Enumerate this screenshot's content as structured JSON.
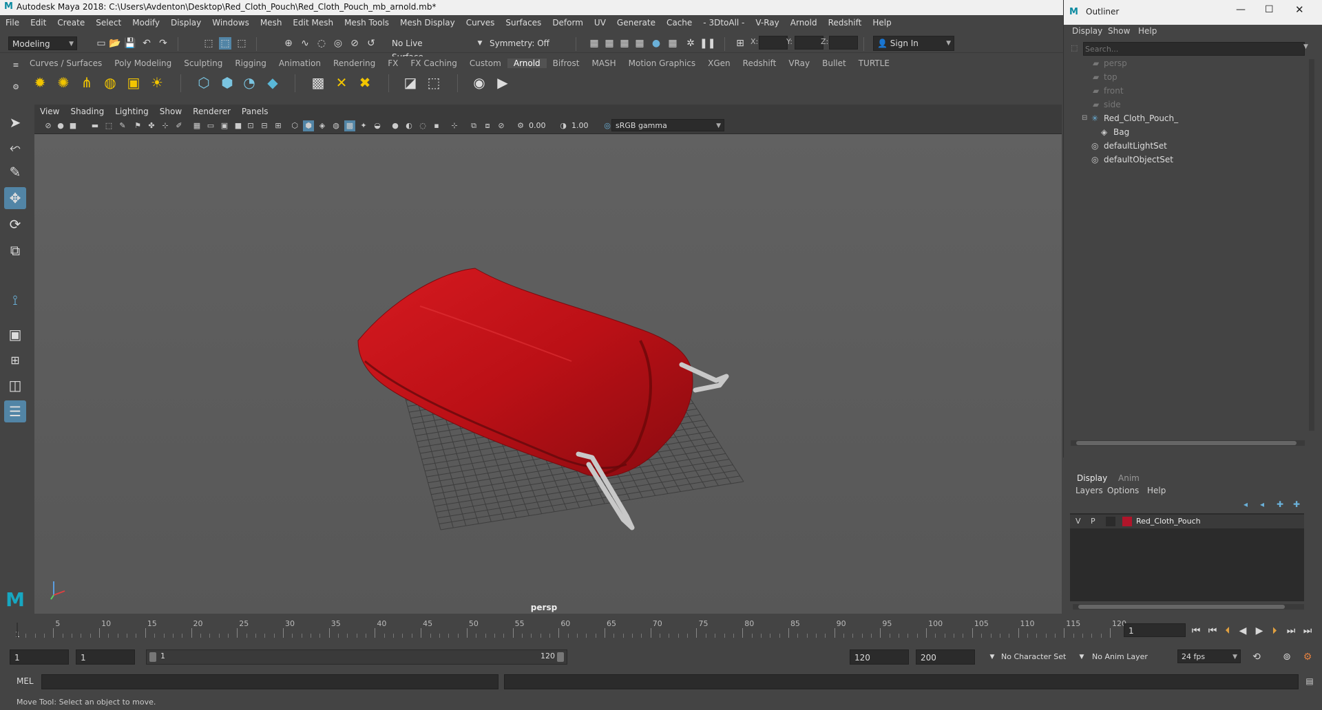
{
  "window": {
    "title": "Autodesk Maya 2018: C:\\Users\\Avdenton\\Desktop\\Red_Cloth_Pouch\\Red_Cloth_Pouch_mb_arnold.mb*",
    "logo": "M"
  },
  "menubar": [
    "File",
    "Edit",
    "Create",
    "Select",
    "Modify",
    "Display",
    "Windows",
    "Mesh",
    "Edit Mesh",
    "Mesh Tools",
    "Mesh Display",
    "Curves",
    "Surfaces",
    "Deform",
    "UV",
    "Generate",
    "Cache",
    "- 3DtoAll -",
    "V-Ray",
    "Arnold",
    "Redshift",
    "Help"
  ],
  "statusline": {
    "mode": "Modeling",
    "live_surface": "No Live Surface",
    "symmetry": "Symmetry: Off",
    "x_label": "X:",
    "y_label": "Y:",
    "z_label": "Z:",
    "sign_in": "Sign In"
  },
  "shelf": {
    "tabs": [
      "Curves / Surfaces",
      "Poly Modeling",
      "Sculpting",
      "Rigging",
      "Animation",
      "Rendering",
      "FX",
      "FX Caching",
      "Custom",
      "Arnold",
      "Bifrost",
      "MASH",
      "Motion Graphics",
      "XGen",
      "Redshift",
      "VRay",
      "Bullet",
      "TURTLE"
    ],
    "active_tab": "Arnold"
  },
  "viewport": {
    "menu": [
      "View",
      "Shading",
      "Lighting",
      "Show",
      "Renderer",
      "Panels"
    ],
    "exposure": "0.00",
    "gamma": "1.00",
    "color_space": "sRGB gamma",
    "camera": "persp",
    "object_color": "#c0141c"
  },
  "timeline": {
    "ticks": [
      "5",
      "10",
      "15",
      "20",
      "25",
      "30",
      "35",
      "40",
      "45",
      "50",
      "55",
      "60",
      "65",
      "70",
      "75",
      "80",
      "85",
      "90",
      "95",
      "100",
      "105",
      "110",
      "115",
      "120"
    ],
    "start_marker": "1",
    "current_frame": "1"
  },
  "range": {
    "start": "1",
    "playback_start": "1",
    "slider_start": "1",
    "slider_end": "120",
    "playback_end": "120",
    "end": "200",
    "character_set": "No Character Set",
    "anim_layer": "No Anim Layer",
    "fps": "24 fps"
  },
  "cmdline": {
    "label": "MEL"
  },
  "helpline": {
    "text": "Move Tool: Select an object to move."
  },
  "outliner": {
    "title": "Outliner",
    "menu": [
      "Display",
      "Show",
      "Help"
    ],
    "search_placeholder": "Search...",
    "items": [
      {
        "label": "persp",
        "dim": true
      },
      {
        "label": "top",
        "dim": true
      },
      {
        "label": "front",
        "dim": true
      },
      {
        "label": "side",
        "dim": true
      },
      {
        "label": "Red_Cloth_Pouch_",
        "dim": false
      },
      {
        "label": "Bag",
        "dim": false
      },
      {
        "label": "defaultLightSet",
        "dim": false
      },
      {
        "label": "defaultObjectSet",
        "dim": false
      }
    ]
  },
  "layer_editor": {
    "tabs": [
      "Display",
      "Anim"
    ],
    "menu": [
      "Layers",
      "Options",
      "Help"
    ],
    "layer": {
      "v": "V",
      "p": "P",
      "name": "Red_Cloth_Pouch",
      "color": "#b0152a"
    }
  }
}
